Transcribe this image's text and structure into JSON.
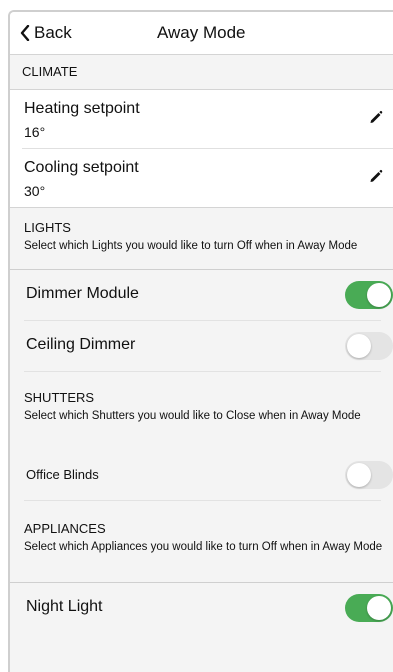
{
  "header": {
    "back_label": "Back",
    "title": "Away Mode"
  },
  "climate": {
    "section_label": "CLIMATE",
    "items": [
      {
        "label": "Heating setpoint",
        "value": "16°"
      },
      {
        "label": "Cooling setpoint",
        "value": "30°"
      }
    ]
  },
  "lights": {
    "section_label": "LIGHTS",
    "description": "Select which Lights you would like to turn Off when in Away Mode",
    "items": [
      {
        "label": "Dimmer Module",
        "enabled": true
      },
      {
        "label": "Ceiling Dimmer",
        "enabled": false
      }
    ]
  },
  "shutters": {
    "section_label": "SHUTTERS",
    "description": "Select which Shutters you would like to Close when in Away Mode",
    "items": [
      {
        "label": "Office Blinds",
        "enabled": false
      }
    ]
  },
  "appliances": {
    "section_label": "APPLIANCES",
    "description": "Select which Appliances you would like to turn Off when in Away Mode",
    "items": [
      {
        "label": "Night Light",
        "enabled": true
      }
    ]
  },
  "colors": {
    "toggle_on": "#49ab55",
    "toggle_off": "#e4e4e4",
    "background": "#f4f4f4"
  },
  "icons": {
    "back": "chevron-left-icon",
    "edit": "pencil-icon"
  }
}
